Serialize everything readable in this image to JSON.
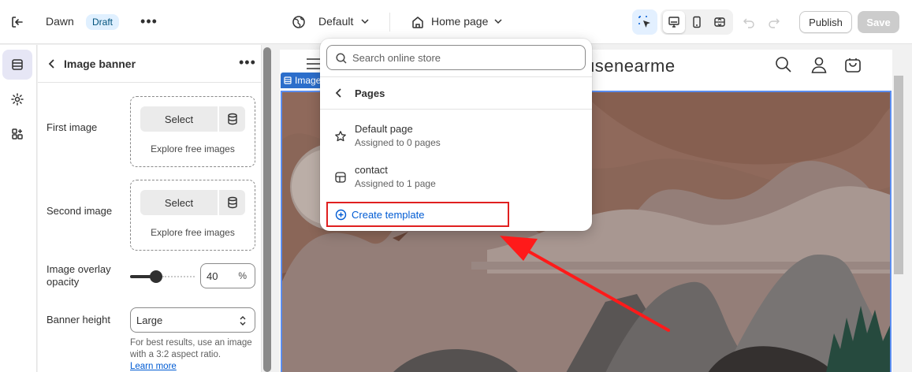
{
  "topbar": {
    "theme_name": "Dawn",
    "draft_badge": "Draft",
    "language": "Default",
    "page": "Home page",
    "publish_label": "Publish",
    "save_label": "Save"
  },
  "panel": {
    "title": "Image banner",
    "first_image_label": "First image",
    "second_image_label": "Second image",
    "select_label": "Select",
    "explore_label": "Explore free images",
    "overlay_label": "Image overlay opacity",
    "overlay_value": "40",
    "overlay_unit": "%",
    "overlay_fraction": 0.4,
    "height_label": "Banner height",
    "height_value": "Large",
    "help_text": "For best results, use an image with a 3:2 aspect ratio.",
    "learn_more": "Learn more"
  },
  "preview": {
    "store_name": "usenearme",
    "section_tag": "Image"
  },
  "popover": {
    "search_placeholder": "Search online store",
    "group_label": "Pages",
    "templates": [
      {
        "name": "Default page",
        "assigned": "Assigned to 0 pages",
        "icon": "star-icon"
      },
      {
        "name": "contact",
        "assigned": "Assigned to 1 page",
        "icon": "page-template-icon"
      }
    ],
    "create_label": "Create template"
  },
  "colors": {
    "accent": "#005bd3",
    "highlight_border": "#e02020",
    "selection_blue": "#5b8def",
    "banner_sky": "#8f6a5c"
  }
}
